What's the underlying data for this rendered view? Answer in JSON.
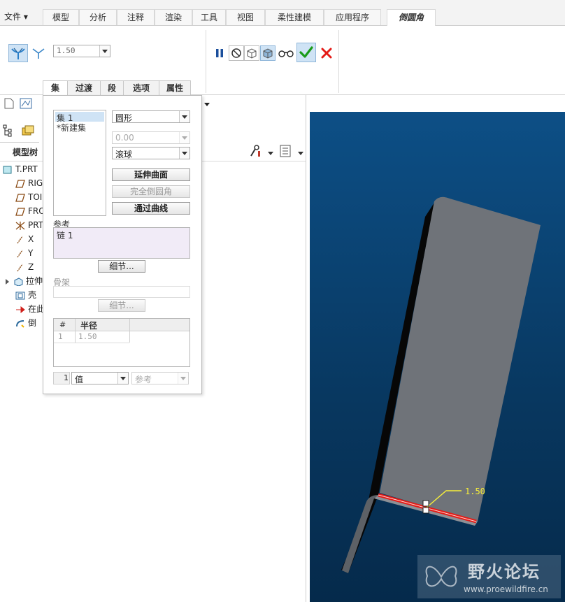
{
  "menubar": {
    "file_label": "文件",
    "tabs": [
      "模型",
      "分析",
      "注释",
      "渲染",
      "工具",
      "视图",
      "柔性建模",
      "应用程序"
    ],
    "active_tab": "倒圆角"
  },
  "ribbon": {
    "radius_value": "1.50"
  },
  "panel_tabs": [
    "集",
    "过渡",
    "段",
    "选项",
    "属性"
  ],
  "left": {
    "model_tree_label": "模型树",
    "tree_items": [
      "T.PRT",
      "RIG",
      "TOI",
      "FRO",
      "PRT",
      "X",
      "Y",
      "Z",
      "拉伸",
      "壳",
      "在此",
      "倒"
    ]
  },
  "set_panel": {
    "sets": [
      "集 1",
      "*新建集"
    ],
    "shape_value": "圆形",
    "distance_value": "0.00",
    "method_value": "滚球",
    "btn_extend_surface": "延伸曲面",
    "btn_full_round": "完全倒圆角",
    "btn_through_curve": "通过曲线",
    "references_label": "参考",
    "references_value": "链 1",
    "details_btn": "细节...",
    "skeleton_label": "骨架",
    "skeleton_details_btn": "细节...",
    "table_headers": [
      "#",
      "半径"
    ],
    "table_rows": [
      {
        "index": "1",
        "radius": "1.50"
      }
    ],
    "bottom_index": "1",
    "bottom_value_mode": "值",
    "bottom_reference_mode": "参考"
  },
  "viewport": {
    "dimension_label": "1.50"
  },
  "watermark": {
    "title": "野火论坛",
    "url": "www.proewildfire.cn"
  },
  "colors": {
    "accent_red": "#e41b17",
    "confirm_green": "#1a9b1a",
    "viewport_blue": "#0b4a80",
    "part_gray": "#6f7379"
  }
}
